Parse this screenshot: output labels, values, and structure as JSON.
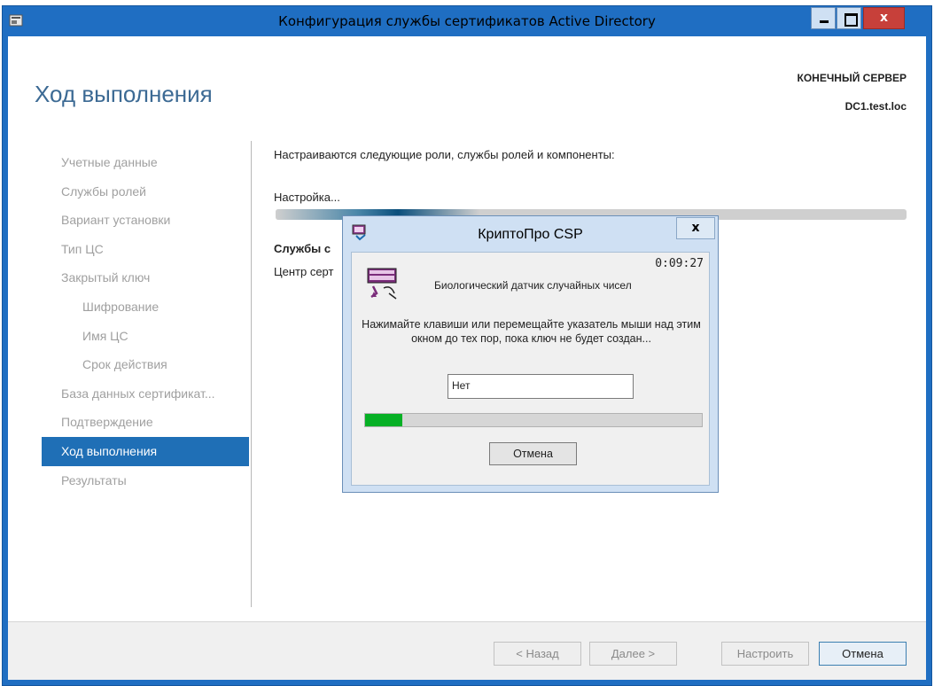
{
  "window": {
    "title": "Конфигурация службы сертификатов Active Directory",
    "close_glyph": "x"
  },
  "header": {
    "page_title": "Ход выполнения",
    "server_label": "КОНЕЧНЫЙ СЕРВЕР",
    "server_name": "DC1.test.loc"
  },
  "sidebar": {
    "items": [
      {
        "label": "Учетные данные"
      },
      {
        "label": "Службы ролей"
      },
      {
        "label": "Вариант установки"
      },
      {
        "label": "Тип ЦС"
      },
      {
        "label": "Закрытый ключ"
      },
      {
        "label": "Шифрование"
      },
      {
        "label": "Имя ЦС"
      },
      {
        "label": "Срок действия"
      },
      {
        "label": "База данных сертификат..."
      },
      {
        "label": "Подтверждение"
      },
      {
        "label": "Ход выполнения"
      },
      {
        "label": "Результаты"
      }
    ]
  },
  "main": {
    "intro": "Настраиваются следующие роли, службы ролей и компоненты:",
    "status": "Настройка...",
    "section_heading": "Службы с",
    "section_item": "Центр серт"
  },
  "footer": {
    "back_label": "< Назад",
    "next_label": "Далее >",
    "configure_label": "Настроить",
    "cancel_label": "Отмена"
  },
  "dialog": {
    "title": "КриптоПро CSP",
    "close_glyph": "x",
    "timer": "0:09:27",
    "sensor_label": "Биологический датчик случайных чисел",
    "instruction": "Нажимайте клавиши или перемещайте указатель мыши над этим окном до тех пор, пока ключ не будет создан...",
    "input_value": "Нет",
    "progress": 0.11,
    "cancel_label": "Отмена"
  },
  "colors": {
    "frame": "#1f6ec2",
    "active_nav": "#1f6fb6",
    "progress_fill": "#06b025",
    "close_button": "#c7403a"
  }
}
